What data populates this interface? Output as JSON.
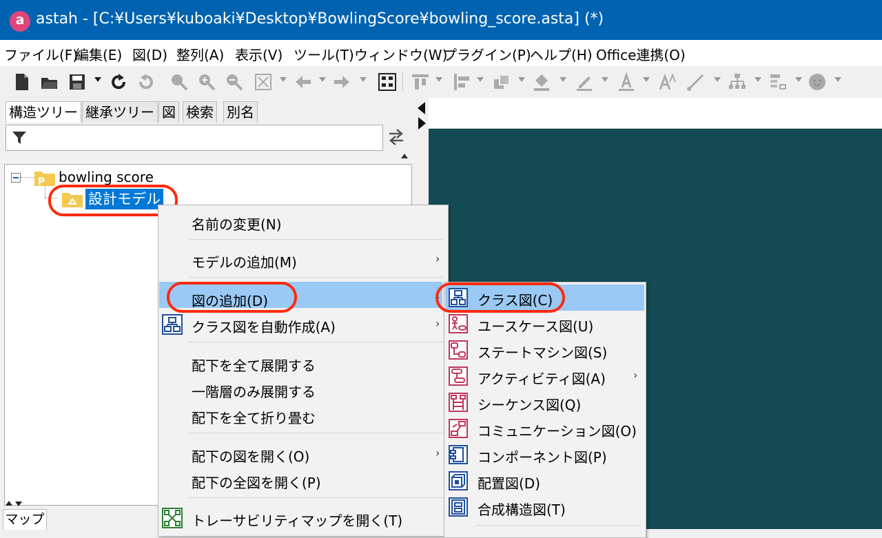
{
  "window": {
    "title": "astah - [C:¥Users¥kuboaki¥Desktop¥BowlingScore¥bowling_score.asta] (*)",
    "app_icon_letter": "a"
  },
  "menubar": {
    "items": [
      "ファイル(F)",
      "編集(E)",
      "図(D)",
      "整列(A)",
      "表示(V)",
      "ツール(T)",
      "ウィンドウ(W)",
      "プラグイン(P)",
      "ヘルプ(H)",
      "Office連携(O)"
    ]
  },
  "left_panel": {
    "tabs": [
      "構造ツリー",
      "継承ツリー",
      "図",
      "検索",
      "別名"
    ],
    "active_tab": "構造ツリー",
    "tree": {
      "root": {
        "label": "bowling score",
        "icon": "project-folder-icon",
        "badge": "P",
        "expanded": true
      },
      "child": {
        "label": "設計モデル",
        "icon": "model-folder-icon",
        "selected": true
      }
    },
    "bottom_tab": "マップ"
  },
  "context_menu": {
    "items": [
      {
        "label": "名前の変更(N)"
      },
      {
        "label": "モデルの追加(M)",
        "submenu": true
      },
      {
        "label": "図の追加(D)",
        "submenu": true,
        "highlighted": true
      },
      {
        "label": "クラス図を自動作成(A)",
        "submenu": true,
        "icon": "class-diagram-icon"
      },
      {
        "label": "配下を全て展開する"
      },
      {
        "label": "一階層のみ展開する"
      },
      {
        "label": "配下を全て折り畳む"
      },
      {
        "label": "配下の図を開く(O)",
        "submenu": true
      },
      {
        "label": "配下の全図を開く(P)"
      },
      {
        "label": "トレーサビリティマップを開く(T)",
        "icon": "traceability-map-icon"
      }
    ]
  },
  "submenu": {
    "items": [
      {
        "label": "クラス図(C)",
        "icon": "class-diagram-icon",
        "highlighted": true
      },
      {
        "label": "ユースケース図(U)",
        "icon": "usecase-diagram-icon"
      },
      {
        "label": "ステートマシン図(S)",
        "icon": "statemachine-diagram-icon"
      },
      {
        "label": "アクティビティ図(A)",
        "icon": "activity-diagram-icon",
        "submenu": true
      },
      {
        "label": "シーケンス図(Q)",
        "icon": "sequence-diagram-icon"
      },
      {
        "label": "コミュニケーション図(O)",
        "icon": "communication-diagram-icon"
      },
      {
        "label": "コンポーネント図(P)",
        "icon": "component-diagram-icon"
      },
      {
        "label": "配置図(D)",
        "icon": "deployment-diagram-icon"
      },
      {
        "label": "合成構造図(T)",
        "icon": "composite-structure-diagram-icon"
      }
    ]
  },
  "colors": {
    "titlebar": "#0063b1",
    "canvas": "#134a53",
    "selection": "#0078d7",
    "menu_highlight": "#99c9f4",
    "annotation_ring": "#ff2a0e",
    "uml_blue_icon": "#1f4e9c",
    "uml_red_icon": "#c0345c"
  }
}
